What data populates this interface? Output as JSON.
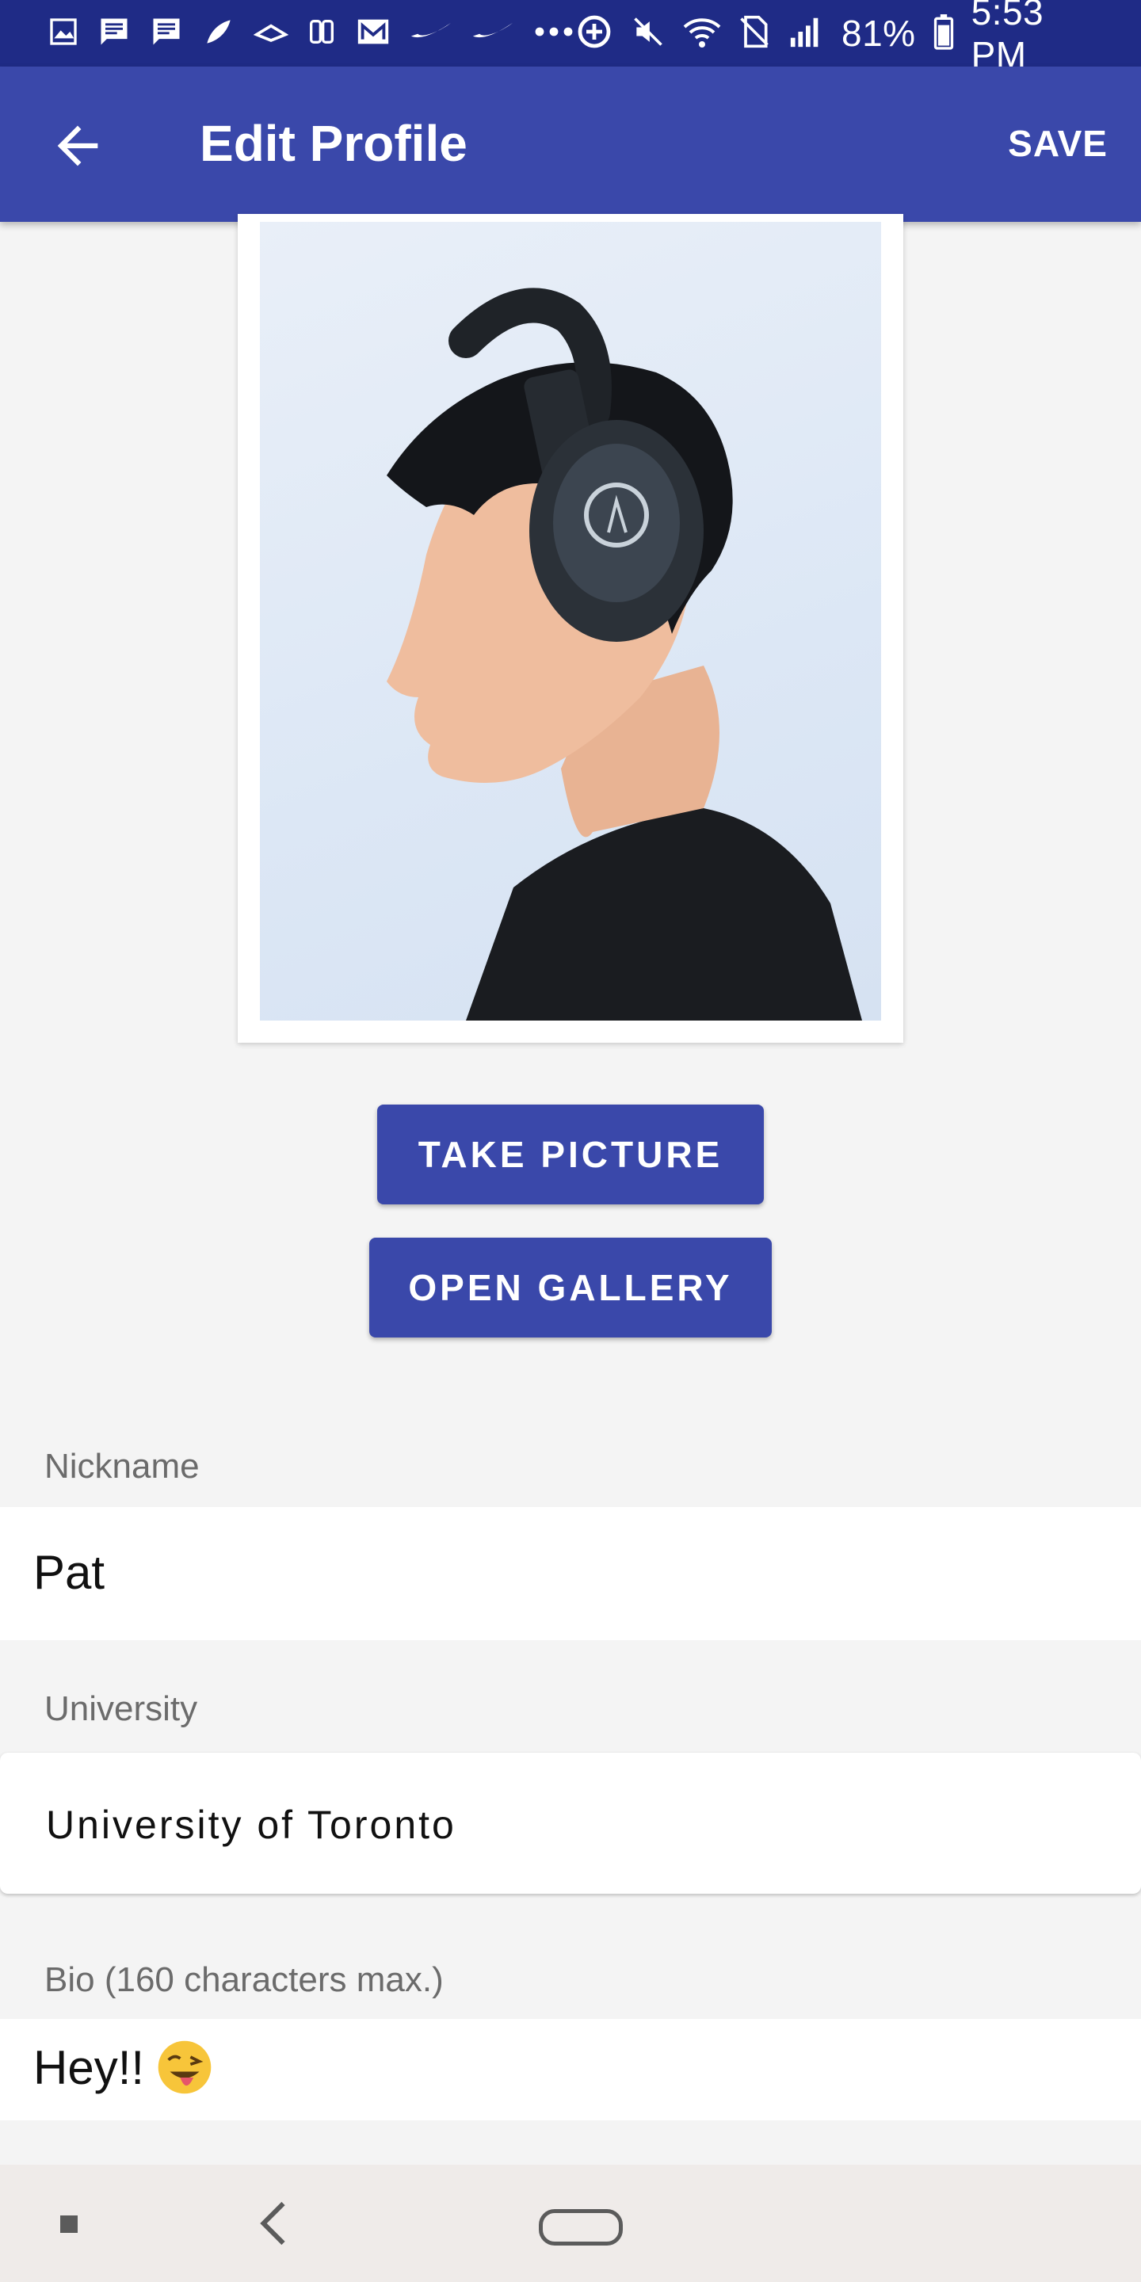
{
  "status_bar": {
    "battery": "81%",
    "time": "5:53 PM",
    "left_icons": [
      "image-icon",
      "message-icon",
      "message-icon",
      "app-icon",
      "app-icon",
      "app-icon",
      "mail-icon",
      "nike-icon",
      "nike-icon",
      "more-dots-icon"
    ],
    "right_icons": [
      "data-saver-icon",
      "mute-icon",
      "wifi-icon",
      "no-sim-icon",
      "signal-icon",
      "battery-icon"
    ]
  },
  "app_bar": {
    "title": "Edit Profile",
    "save_label": "SAVE",
    "back_icon": "arrow-back-icon"
  },
  "profile_photo": {
    "alt": "profile-photo"
  },
  "buttons": {
    "take_picture": "TAKE PICTURE",
    "open_gallery": "OPEN GALLERY"
  },
  "form": {
    "nickname": {
      "label": "Nickname",
      "value": "Pat"
    },
    "university": {
      "label": "University",
      "value": "University of Toronto"
    },
    "bio": {
      "label": "Bio (160 characters max.)",
      "value": "Hey!!",
      "emoji": "winking-face-with-tongue-emoji"
    }
  },
  "colors": {
    "status_bar": "#1f2b86",
    "primary": "#3a48aa",
    "background": "#f4f4f4",
    "nav_bar": "#efebe9"
  }
}
